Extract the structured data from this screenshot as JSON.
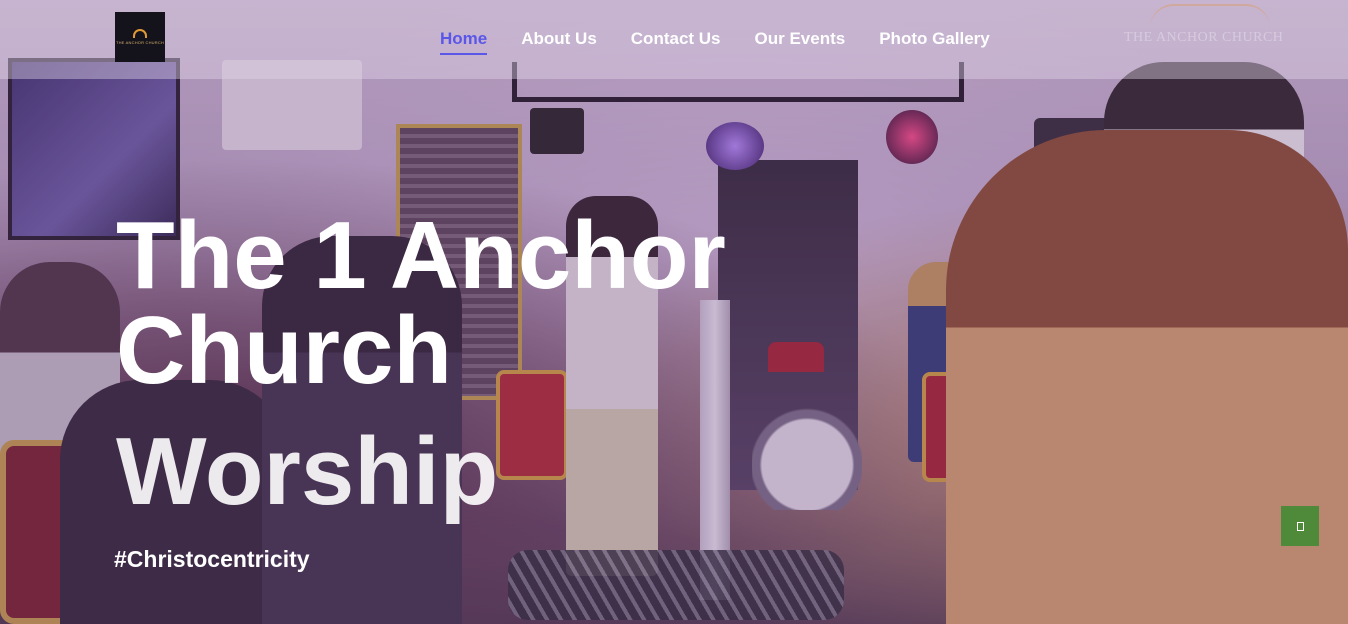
{
  "header": {
    "logo_text": "The Anchor Church",
    "nav": [
      {
        "label": "Home",
        "active": true
      },
      {
        "label": "About Us",
        "active": false
      },
      {
        "label": "Contact Us",
        "active": false
      },
      {
        "label": "Our Events",
        "active": false
      },
      {
        "label": "Photo Gallery",
        "active": false
      }
    ],
    "watermark_text": "The Anchor Church"
  },
  "hero": {
    "title_line1": "The 1 Anchor Church",
    "title_line2": "Worship",
    "tagline": "#Christocentricity"
  },
  "back_to_top": {
    "icon": "square-icon"
  },
  "colors": {
    "nav_active": "#5a57e8",
    "nav_text": "#ffffff",
    "back_to_top_bg": "#4e8a3a",
    "logo_bg": "#14121a"
  }
}
